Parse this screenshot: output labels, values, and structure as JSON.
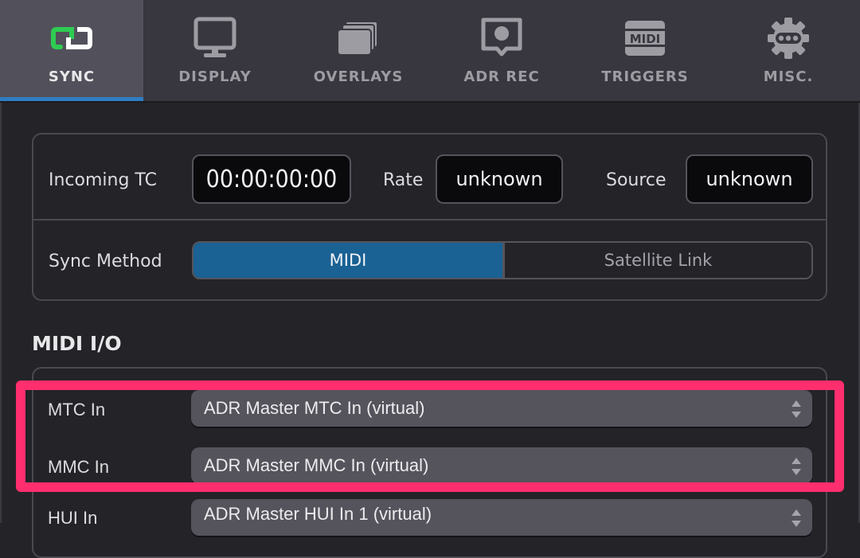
{
  "tabs": [
    {
      "label": "SYNC",
      "icon": "sync-link-icon",
      "active": true
    },
    {
      "label": "DISPLAY",
      "icon": "monitor-icon",
      "active": false
    },
    {
      "label": "OVERLAYS",
      "icon": "layers-icon",
      "active": false
    },
    {
      "label": "ADR REC",
      "icon": "record-pin-icon",
      "active": false
    },
    {
      "label": "TRIGGERS",
      "icon": "midi-icon",
      "active": false
    },
    {
      "label": "MISC.",
      "icon": "gear-dots-icon",
      "active": false
    }
  ],
  "colors": {
    "accent_blue": "#1a6194",
    "tab_indicator": "#2f7ec4",
    "sync_green": "#2ecc52",
    "highlight": "#ff2e6e"
  },
  "status": {
    "incoming_tc_label": "Incoming TC",
    "incoming_tc_value": "00:00:00:00",
    "rate_label": "Rate",
    "rate_value": "unknown",
    "source_label": "Source",
    "source_value": "unknown"
  },
  "sync_method": {
    "label": "Sync Method",
    "options": [
      "MIDI",
      "Satellite Link"
    ],
    "selected": "MIDI"
  },
  "midi_io": {
    "title": "MIDI I/O",
    "rows": [
      {
        "label": "MTC In",
        "value": "ADR Master MTC In (virtual)"
      },
      {
        "label": "MMC In",
        "value": "ADR Master MMC In (virtual)"
      },
      {
        "label": "HUI In",
        "value": "ADR Master HUI In 1 (virtual)"
      }
    ]
  }
}
